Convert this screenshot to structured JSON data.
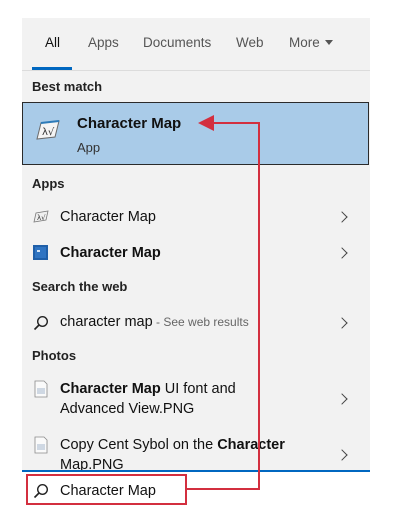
{
  "tabs": [
    {
      "label": "All",
      "active": true
    },
    {
      "label": "Apps"
    },
    {
      "label": "Documents"
    },
    {
      "label": "Web"
    },
    {
      "label": "More"
    }
  ],
  "sections": {
    "best_match": "Best match",
    "apps": "Apps",
    "web": "Search the web",
    "photos": "Photos"
  },
  "best_match": {
    "title": "Character Map",
    "subtitle": "App",
    "icon": "character-map-icon"
  },
  "apps": [
    {
      "label": "Character Map",
      "icon": "character-map-small-icon"
    },
    {
      "label": "Character Map",
      "icon": "blue-app-tile-icon"
    }
  ],
  "web": {
    "query": "character map",
    "suffix": " - See web results",
    "icon": "search-icon"
  },
  "photos": [
    {
      "bold": "Character Map",
      "line1_rest": " UI font and",
      "line2": "Advanced View.PNG",
      "icon": "image-file-icon"
    },
    {
      "line1_start": "Copy Cent Sybol on the ",
      "bold": "Character",
      "line2": "Map.PNG",
      "icon": "image-file-icon"
    }
  ],
  "search": {
    "value": "Character Map",
    "icon": "search-icon"
  },
  "colors": {
    "accent": "#0067c0",
    "highlight": "#a9cbe8",
    "annotation": "#d32f3f"
  }
}
